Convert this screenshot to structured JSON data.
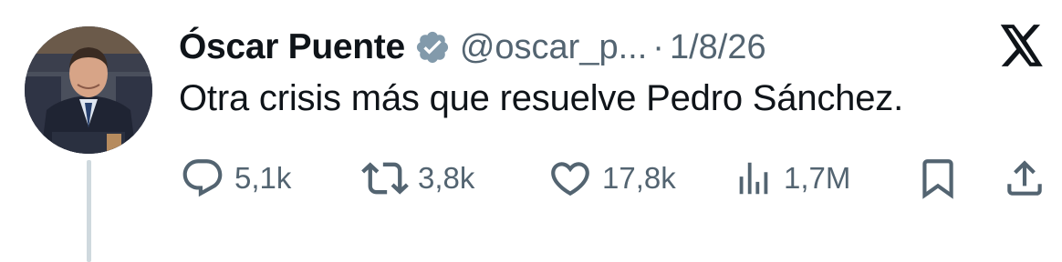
{
  "tweet": {
    "author_name": "Óscar Puente",
    "verified": true,
    "handle": "@oscar_p...",
    "separator": "·",
    "date": "1/8/26",
    "text": "Otra crisis más que resuelve Pedro Sánchez."
  },
  "actions": {
    "replies": "5,1k",
    "reposts": "3,8k",
    "likes": "17,8k",
    "views": "1,7M"
  },
  "icons": {
    "platform_logo": "x-logo-icon",
    "verified": "verified-badge-icon",
    "reply": "reply-icon",
    "repost": "repost-icon",
    "like": "heart-icon",
    "views": "views-icon",
    "bookmark": "bookmark-icon",
    "share": "share-icon"
  },
  "colors": {
    "text_primary": "#0f1419",
    "text_secondary": "#536471",
    "verified_badge": "#829aab",
    "thread_line": "#cfd9de"
  }
}
